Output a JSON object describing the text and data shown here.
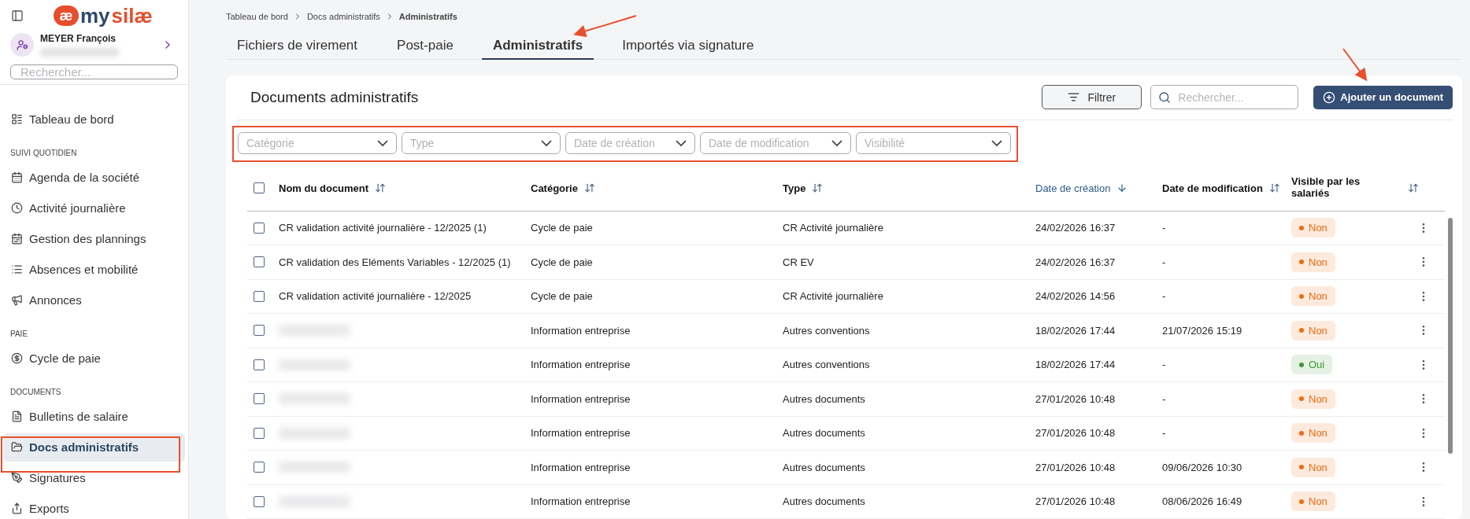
{
  "logo": {
    "mark": "æ",
    "word_1": "my",
    "word_2": "silæ"
  },
  "user": {
    "name": "MEYER François"
  },
  "sidebar": {
    "search": {
      "placeholder": "Rechercher..."
    },
    "sections": [
      {
        "items": [
          {
            "label": "Tableau de bord",
            "selected": false
          }
        ]
      },
      {
        "heading": "SUIVI QUOTIDIEN",
        "items": [
          {
            "label": "Agenda de la société",
            "selected": false
          },
          {
            "label": "Activité journalière",
            "selected": false
          },
          {
            "label": "Gestion des plannings",
            "selected": false
          },
          {
            "label": "Absences et mobilité",
            "selected": false
          },
          {
            "label": "Annonces",
            "selected": false
          }
        ]
      },
      {
        "heading": "PAIE",
        "items": [
          {
            "label": "Cycle de paie",
            "selected": false
          }
        ]
      },
      {
        "heading": "DOCUMENTS",
        "items": [
          {
            "label": "Bulletins de salaire",
            "selected": false
          },
          {
            "label": "Docs administratifs",
            "selected": true
          },
          {
            "label": "Signatures",
            "selected": false
          },
          {
            "label": "Exports",
            "selected": false
          }
        ]
      }
    ]
  },
  "breadcrumb": [
    "Tableau de bord",
    "Docs administratifs",
    "Administratifs"
  ],
  "tabs": [
    {
      "label": "Fichiers de virement",
      "selected": false
    },
    {
      "label": "Post-paie",
      "selected": false
    },
    {
      "label": "Administratifs",
      "selected": true
    },
    {
      "label": "Importés via signature",
      "selected": false
    }
  ],
  "card": {
    "title": "Documents administratifs",
    "filter_button": "Filtrer",
    "search": {
      "placeholder": "Rechercher..."
    },
    "add_button": "Ajouter un document",
    "filters": [
      {
        "placeholder": "Catégorie"
      },
      {
        "placeholder": "Type"
      },
      {
        "placeholder": "Date de création"
      },
      {
        "placeholder": "Date de modification"
      },
      {
        "placeholder": "Visibilité"
      }
    ]
  },
  "table": {
    "select_all": {
      "checked": false
    },
    "columns": [
      {
        "label": "Nom du document",
        "sorted": false
      },
      {
        "label": "Catégorie",
        "sorted": false
      },
      {
        "label": "Type",
        "sorted": false
      },
      {
        "label": "Date de création",
        "sorted": true
      },
      {
        "label": "Date de modification",
        "sorted": false
      },
      {
        "label": "Visible par les salariés",
        "sorted": false
      }
    ],
    "rows": [
      {
        "checked": false,
        "name": "CR validation activité journalière - 12/2025 (1)",
        "category": "Cycle de paie",
        "type": "CR Activité journalière",
        "created": "24/02/2026 16:37",
        "modified": "-",
        "visible": false,
        "visibility": "Non"
      },
      {
        "checked": false,
        "name": "CR validation des Eléments Variables - 12/2025 (1)",
        "category": "Cycle de paie",
        "type": "CR EV",
        "created": "24/02/2026 16:37",
        "modified": "-",
        "visible": false,
        "visibility": "Non"
      },
      {
        "checked": false,
        "name": "CR validation activité journalière - 12/2025",
        "category": "Cycle de paie",
        "type": "CR Activité journalière",
        "created": "24/02/2026 14:56",
        "modified": "-",
        "visible": false,
        "visibility": "Non"
      },
      {
        "checked": false,
        "category": "Information entreprise",
        "type": "Autres conventions",
        "created": "18/02/2026 17:44",
        "modified": "21/07/2026 15:19",
        "visible": false,
        "visibility": "Non"
      },
      {
        "checked": false,
        "category": "Information entreprise",
        "type": "Autres conventions",
        "created": "18/02/2026 17:44",
        "modified": "-",
        "visible": true,
        "visibility": "Oui"
      },
      {
        "checked": false,
        "category": "Information entreprise",
        "type": "Autres documents",
        "created": "27/01/2026 10:48",
        "modified": "-",
        "visible": false,
        "visibility": "Non"
      },
      {
        "checked": false,
        "category": "Information entreprise",
        "type": "Autres documents",
        "created": "27/01/2026 10:48",
        "modified": "-",
        "visible": false,
        "visibility": "Non"
      },
      {
        "checked": false,
        "category": "Information entreprise",
        "type": "Autres documents",
        "created": "27/01/2026 10:48",
        "modified": "09/06/2026 10:30",
        "visible": false,
        "visibility": "Non"
      },
      {
        "checked": false,
        "category": "Information entreprise",
        "type": "Autres documents",
        "created": "27/01/2026 10:48",
        "modified": "08/06/2026 16:49",
        "visible": false,
        "visibility": "Non"
      }
    ]
  }
}
